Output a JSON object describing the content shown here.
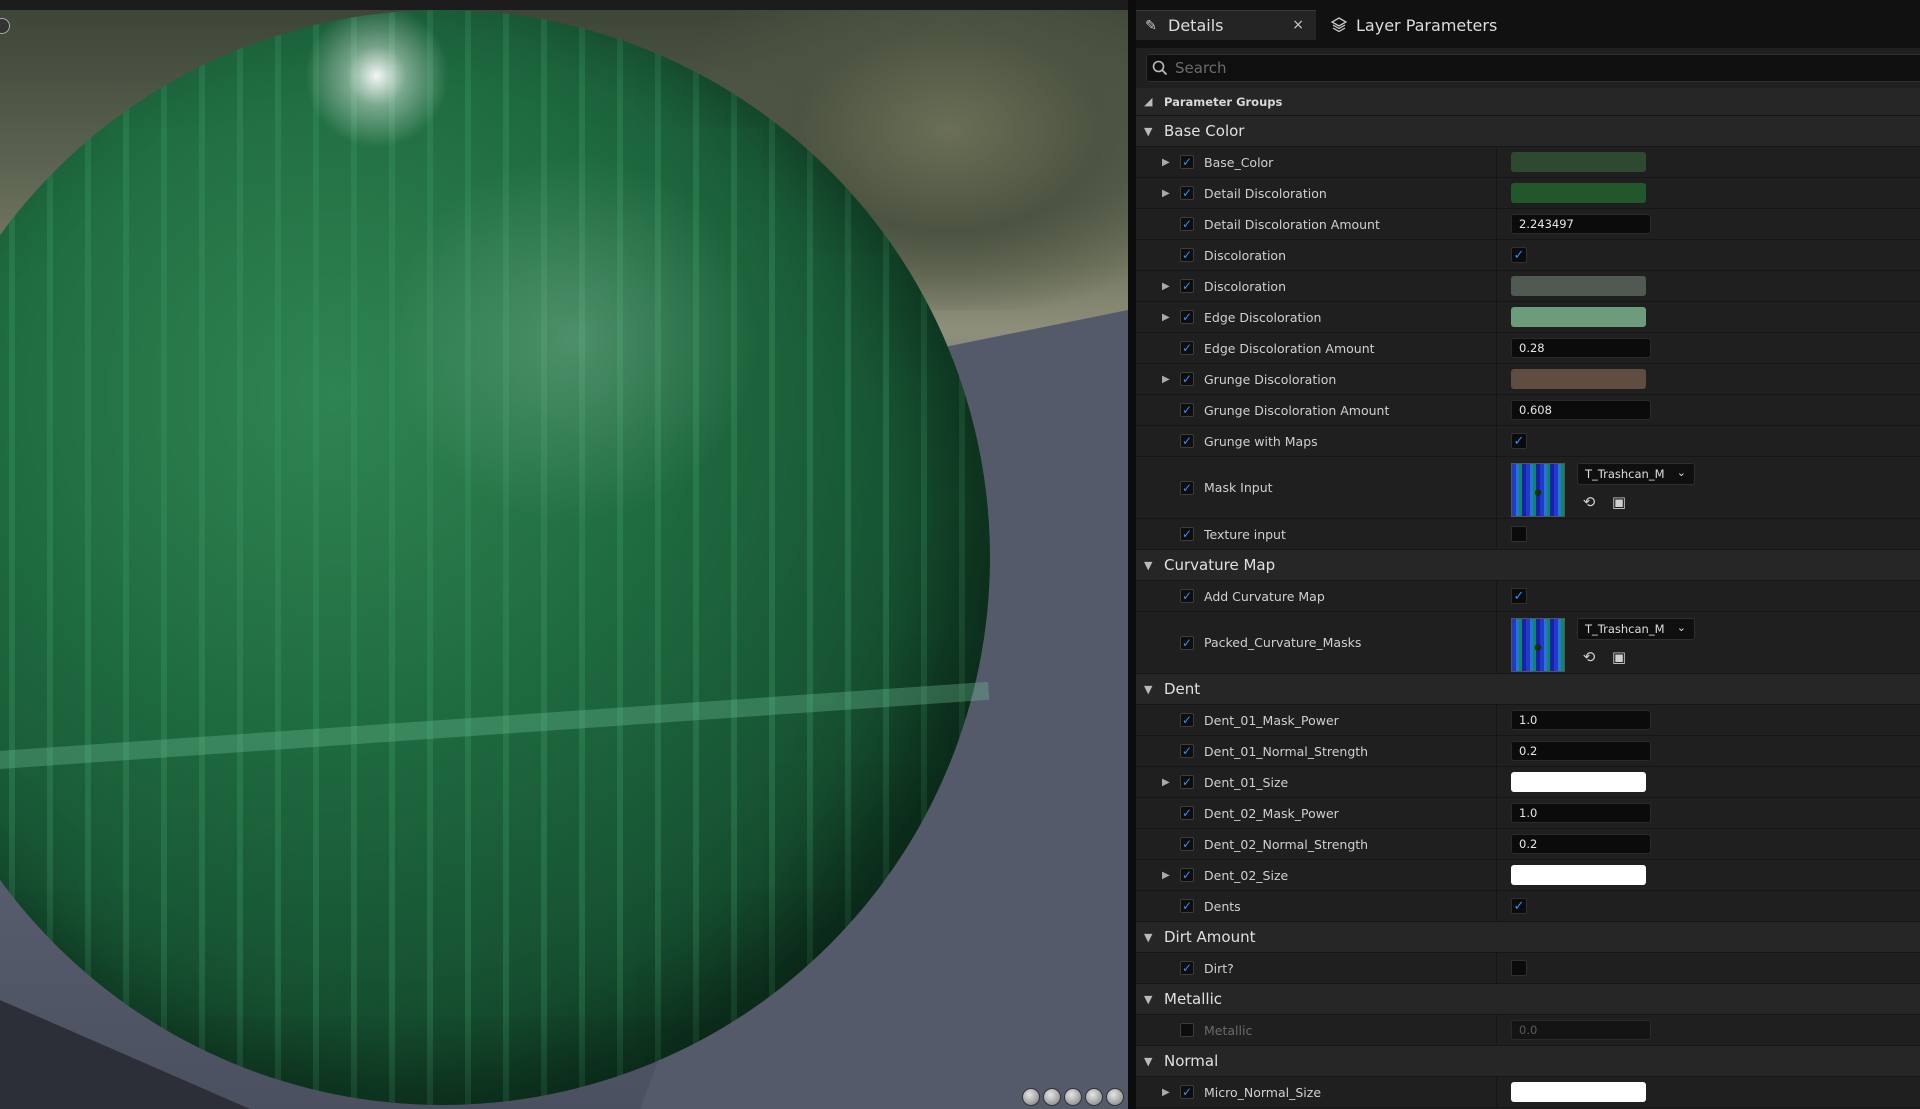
{
  "tabs": {
    "details_label": "Details",
    "details_close": "×",
    "layers_label": "Layer Parameters"
  },
  "search": {
    "placeholder": "Search"
  },
  "groups": {
    "parameter_groups": "Parameter Groups",
    "base_color": "Base Color",
    "curvature_map": "Curvature Map",
    "dent": "Dent",
    "dirt_amount": "Dirt Amount",
    "metallic": "Metallic",
    "normal": "Normal"
  },
  "params": {
    "base_color": {
      "name": "Base_Color",
      "enabled": true,
      "value_type": "color",
      "color": "#2d4a31",
      "expandable": true
    },
    "detail_discoloration": {
      "name": "Detail Discoloration",
      "enabled": true,
      "value_type": "color",
      "color": "#22572c",
      "expandable": true
    },
    "detail_discoloration_amount": {
      "name": "Detail Discoloration Amount",
      "enabled": true,
      "value": "2.243497"
    },
    "discoloration_bool": {
      "name": "Discoloration",
      "enabled": true,
      "checked": true
    },
    "discoloration_color": {
      "name": "Discoloration",
      "enabled": true,
      "value_type": "color",
      "color": "#515a52",
      "expandable": true
    },
    "edge_discoloration": {
      "name": "Edge Discoloration",
      "enabled": true,
      "value_type": "color",
      "color": "#6d9c7c",
      "expandable": true
    },
    "edge_discoloration_amount": {
      "name": "Edge Discoloration Amount",
      "enabled": true,
      "value": "0.28"
    },
    "grunge_discoloration": {
      "name": "Grunge Discoloration",
      "enabled": true,
      "value_type": "color",
      "color": "#5e4d40",
      "expandable": true
    },
    "grunge_discoloration_amount": {
      "name": "Grunge Discoloration Amount",
      "enabled": true,
      "value": "0.608"
    },
    "grunge_with_maps": {
      "name": "Grunge with Maps",
      "enabled": true,
      "checked": true
    },
    "mask_input": {
      "name": "Mask Input",
      "enabled": true,
      "texture": "T_Trashcan_M"
    },
    "texture_input": {
      "name": "Texture input",
      "enabled": true,
      "checked": false
    },
    "add_curvature_map": {
      "name": "Add Curvature Map",
      "enabled": true,
      "checked": true
    },
    "packed_curvature_masks": {
      "name": "Packed_Curvature_Masks",
      "enabled": true,
      "texture": "T_Trashcan_M"
    },
    "dent_01_mask_power": {
      "name": "Dent_01_Mask_Power",
      "enabled": true,
      "value": "1.0"
    },
    "dent_01_normal_strength": {
      "name": "Dent_01_Normal_Strength",
      "enabled": true,
      "value": "0.2"
    },
    "dent_01_size": {
      "name": "Dent_01_Size",
      "enabled": true,
      "value_type": "color",
      "color": "#ffffff",
      "expandable": true
    },
    "dent_02_mask_power": {
      "name": "Dent_02_Mask_Power",
      "enabled": true,
      "value": "1.0"
    },
    "dent_02_normal_strength": {
      "name": "Dent_02_Normal_Strength",
      "enabled": true,
      "value": "0.2"
    },
    "dent_02_size": {
      "name": "Dent_02_Size",
      "enabled": true,
      "value_type": "color",
      "color": "#ffffff",
      "expandable": true
    },
    "dents": {
      "name": "Dents",
      "enabled": true,
      "checked": true
    },
    "dirt": {
      "name": "Dirt?",
      "enabled": true,
      "checked": false
    },
    "metallic": {
      "name": "Metallic",
      "enabled": false,
      "value": "0.0"
    },
    "micro_normal_size": {
      "name": "Micro_Normal_Size",
      "enabled": true,
      "value_type": "color",
      "color": "#ffffff",
      "expandable": true
    }
  },
  "colors": {
    "checkbox_check": "#2f8fff",
    "panel_bg": "#1f1f1f",
    "group_bg": "#262626"
  },
  "icons": {
    "details_tab": "pencil-icon",
    "layers_tab": "layers-icon",
    "search": "search-icon",
    "reset": "reset-arrow-icon",
    "browse": "browse-folder-icon"
  }
}
